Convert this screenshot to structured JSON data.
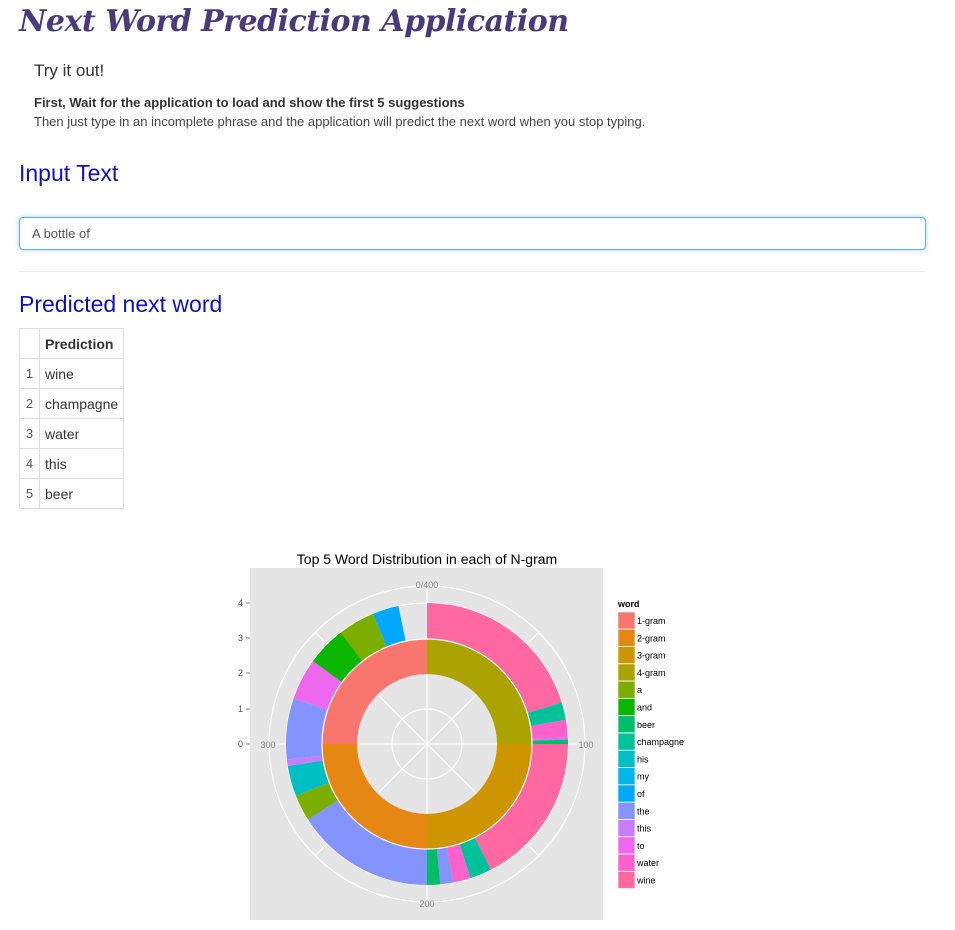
{
  "app": {
    "title": "Next Word Prediction Application"
  },
  "intro": {
    "try_it": "Try it out!",
    "instruction_bold": "First, Wait for the application to load and show the first 5 suggestions",
    "instruction": "Then just type in an incomplete phrase and the application will predict the next word when you stop typing."
  },
  "input_section": {
    "heading": "Input Text",
    "value": "A bottle of"
  },
  "prediction_section": {
    "heading": "Predicted next word",
    "column_header": "Prediction",
    "rows": [
      {
        "index": "1",
        "word": "wine"
      },
      {
        "index": "2",
        "word": "champagne"
      },
      {
        "index": "3",
        "word": "water"
      },
      {
        "index": "4",
        "word": "this"
      },
      {
        "index": "5",
        "word": "beer"
      }
    ]
  },
  "chart_data": {
    "type": "pie",
    "title": "Top 5 Word Distribution in each of N-gram",
    "legend_title": "word",
    "legend_position": "right",
    "theta_ticks": [
      "0/400",
      "100",
      "200",
      "300"
    ],
    "r_ticks": [
      "0",
      "1",
      "2",
      "3",
      "4"
    ],
    "theta_max": 400,
    "grid": true,
    "legend": [
      {
        "name": "1-gram",
        "color": "#F8766D"
      },
      {
        "name": "2-gram",
        "color": "#E68613"
      },
      {
        "name": "3-gram",
        "color": "#CD9600"
      },
      {
        "name": "4-gram",
        "color": "#ABA300"
      },
      {
        "name": "a",
        "color": "#7CAE00"
      },
      {
        "name": "and",
        "color": "#0CB702"
      },
      {
        "name": "beer",
        "color": "#00BE67"
      },
      {
        "name": "champagne",
        "color": "#00C19A"
      },
      {
        "name": "his",
        "color": "#00BFC4"
      },
      {
        "name": "my",
        "color": "#00B8E7"
      },
      {
        "name": "of",
        "color": "#00A9FF"
      },
      {
        "name": "the",
        "color": "#8494FF"
      },
      {
        "name": "this",
        "color": "#C77CFF"
      },
      {
        "name": "to",
        "color": "#ED68ED"
      },
      {
        "name": "water",
        "color": "#FF61CC"
      },
      {
        "name": "wine",
        "color": "#FF68A1"
      }
    ],
    "inner_ring": [
      {
        "name": "4-gram",
        "start": 0,
        "end": 100
      },
      {
        "name": "3-gram",
        "start": 100,
        "end": 200
      },
      {
        "name": "2-gram",
        "start": 200,
        "end": 300
      },
      {
        "name": "1-gram",
        "start": 300,
        "end": 400
      }
    ],
    "outer_ring": [
      {
        "name": "wine",
        "start": 0,
        "end": 81
      },
      {
        "name": "champagne",
        "start": 81,
        "end": 89
      },
      {
        "name": "water",
        "start": 89,
        "end": 97
      },
      {
        "name": "this",
        "start": 97,
        "end": 98
      },
      {
        "name": "beer",
        "start": 98,
        "end": 100
      },
      {
        "name": "wine",
        "start": 100,
        "end": 170
      },
      {
        "name": "champagne",
        "start": 170,
        "end": 180
      },
      {
        "name": "water",
        "start": 180,
        "end": 188
      },
      {
        "name": "the",
        "start": 188,
        "end": 194
      },
      {
        "name": "beer",
        "start": 194,
        "end": 200
      },
      {
        "name": "the",
        "start": 200,
        "end": 264
      },
      {
        "name": "a",
        "start": 264,
        "end": 276
      },
      {
        "name": "his",
        "start": 276,
        "end": 290
      },
      {
        "name": "this",
        "start": 290,
        "end": 293
      },
      {
        "name": "the",
        "start": 293,
        "end": 321
      },
      {
        "name": "to",
        "start": 321,
        "end": 340
      },
      {
        "name": "and",
        "start": 340,
        "end": 358
      },
      {
        "name": "a",
        "start": 358,
        "end": 375
      },
      {
        "name": "of",
        "start": 375,
        "end": 387
      }
    ]
  }
}
